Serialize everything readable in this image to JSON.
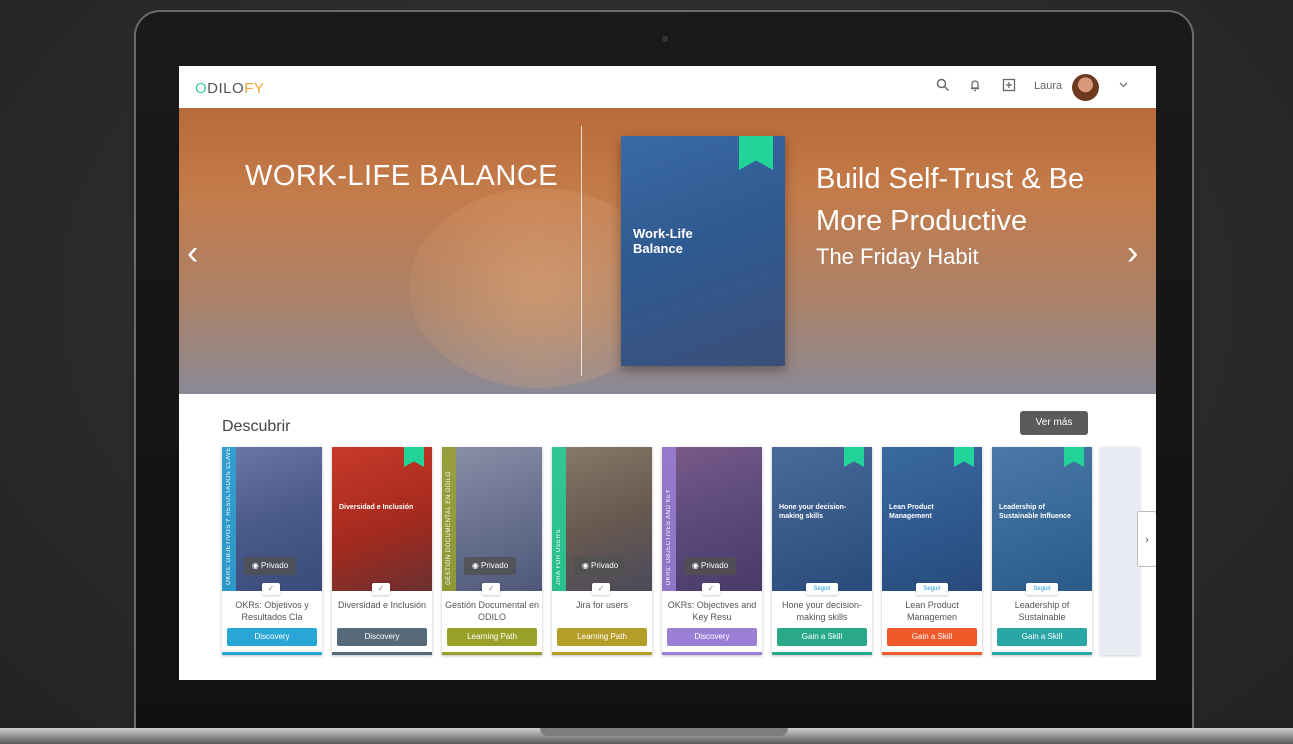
{
  "app": {
    "logo_o": "O",
    "logo_dilo": "DILO",
    "logo_fy": "FY"
  },
  "header": {
    "user_name": "Laura",
    "icons": [
      "search-icon",
      "bell-icon",
      "add-square-icon",
      "chevron-down-icon"
    ]
  },
  "hero": {
    "collection_title": "WORK-LIFE BALANCE",
    "cover_text": "Work-Life Balance",
    "book_title": "Build Self-Trust & Be More Productive",
    "book_subtitle": "The Friday Habit",
    "prev_arrow": "‹",
    "next_arrow": "›"
  },
  "discover": {
    "title": "Descubrir",
    "ver_mas": "Ver más",
    "privado": "Privado",
    "seguir": "Seguir",
    "cards": [
      {
        "title": "OKRs: Objetivos y Resultados Cla",
        "tag": "Discovery",
        "spine": "OKRs: OBJETIVOS Y RESULTADOS CLAVE",
        "cover_text": "",
        "tag_color": "#2aa6d6"
      },
      {
        "title": "Diversidad e Inclusión",
        "tag": "Discovery",
        "spine": "",
        "cover_text": "Diversidad e Inclusión",
        "tag_color": "#566a7a"
      },
      {
        "title": "Gestión Documental en ODILO",
        "tag": "Learning Path",
        "spine": "GESTIÓN DOCUMENTAL EN ODILO",
        "cover_text": "",
        "tag_color": "#9aa12a"
      },
      {
        "title": "Jira for users",
        "tag": "Learning Path",
        "spine": "JIRA FOR USERS",
        "cover_text": "",
        "tag_color": "#b59d2a"
      },
      {
        "title": "OKRs: Objectives and Key Resu",
        "tag": "Discovery",
        "spine": "OKRs: OBJECTIVES AND KEY",
        "cover_text": "",
        "tag_color": "#9b7fd6"
      },
      {
        "title": "Hone your decision-making skills",
        "tag": "Gain a Skill",
        "spine": "",
        "cover_text": "Hone your decision-making skills",
        "tag_color": "#2aa98a"
      },
      {
        "title": "Lean Product Managemen",
        "tag": "Gain a Skill",
        "spine": "",
        "cover_text": "Lean Product Management",
        "tag_color": "#f05a2a"
      },
      {
        "title": "Leadership of Sustainable",
        "tag": "Gain a Skill",
        "spine": "",
        "cover_text": "Leadership of Sustainable Influence",
        "tag_color": "#2aa6a6"
      }
    ]
  }
}
